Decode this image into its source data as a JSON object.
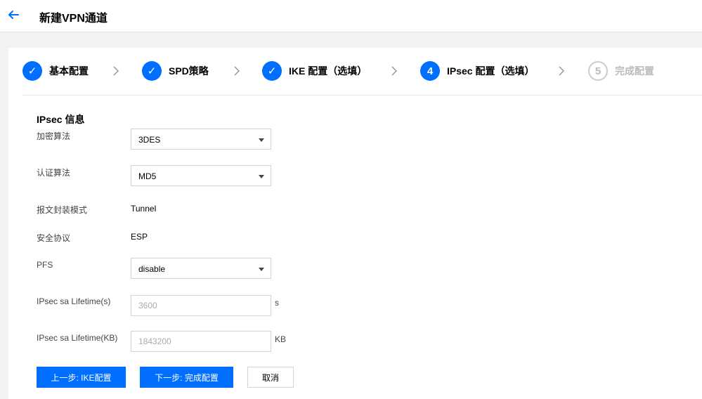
{
  "header": {
    "title": "新建VPN通道"
  },
  "steps": [
    {
      "label": "基本配置",
      "number": "✓",
      "state": "done"
    },
    {
      "label": "SPD策略",
      "number": "✓",
      "state": "done"
    },
    {
      "label": "IKE 配置（选填）",
      "number": "✓",
      "state": "done"
    },
    {
      "label": "IPsec 配置（选填）",
      "number": "4",
      "state": "active"
    },
    {
      "label": "完成配置",
      "number": "5",
      "state": "todo"
    }
  ],
  "form": {
    "section_title": "IPsec 信息",
    "encryption": {
      "label": "加密算法",
      "value": "3DES"
    },
    "auth": {
      "label": "认证算法",
      "value": "MD5"
    },
    "encap_mode": {
      "label": "报文封装模式",
      "value": "Tunnel"
    },
    "protocol": {
      "label": "安全协议",
      "value": "ESP"
    },
    "pfs": {
      "label": "PFS",
      "value": "disable"
    },
    "lifetime_s": {
      "label": "IPsec sa Lifetime(s)",
      "placeholder": "3600",
      "unit": "s"
    },
    "lifetime_kb": {
      "label": "IPsec sa Lifetime(KB)",
      "placeholder": "1843200",
      "unit": "KB"
    }
  },
  "buttons": {
    "prev": "上一步: IKE配置",
    "next": "下一步: 完成配置",
    "cancel": "取消"
  },
  "colors": {
    "accent": "#006eff",
    "inactive": "#bbbbbb"
  }
}
